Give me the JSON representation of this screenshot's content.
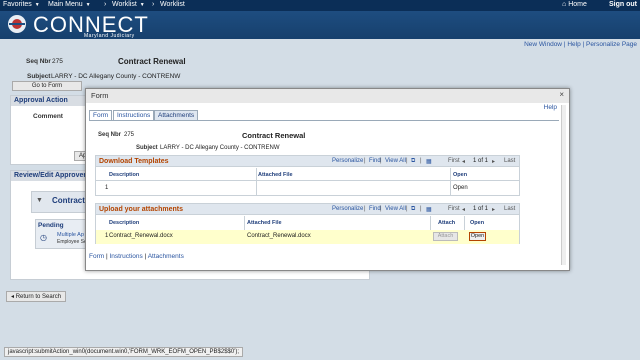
{
  "topnav": {
    "favorites": "Favorites",
    "main_menu": "Main Menu",
    "worklist1": "Worklist",
    "worklist2": "Worklist",
    "home": "Home",
    "signout": "Sign out"
  },
  "banner": {
    "logo_text": "CONNECT",
    "logo_sub": "Maryland Judiciary"
  },
  "page_links": {
    "new_window": "New Window",
    "help": "Help",
    "personalize": "Personalize Page",
    "sep": "|"
  },
  "bg": {
    "seq_label": "Seq Nbr",
    "seq_value": "275",
    "title": "Contract Renewal",
    "subject_label": "Subject",
    "subject_value": "LARRY - DC Allegany County - CONTRENW",
    "go_to_form": "Go to Form",
    "approval_action": "Approval Action",
    "comment_label": "Comment",
    "ap_button": "Ap",
    "review_edit": "Review/Edit Approvers",
    "contract_partial": "Contract",
    "pending": "Pending",
    "multiple_ap": "Multiple Ap",
    "employee_se": "Employee Se",
    "return_to_search": "Return to Search"
  },
  "modal": {
    "title": "Form",
    "help": "Help",
    "close": "×",
    "tabs": [
      "Form",
      "Instructions",
      "Attachments"
    ],
    "seq_label": "Seq Nbr",
    "seq_value": "275",
    "heading": "Contract Renewal",
    "subject_label": "Subject",
    "subject_value": "LARRY - DC Allegany County - CONTRENW",
    "download": {
      "title": "Download Templates",
      "personalize": "Personalize",
      "find": "Find",
      "view_all": "View All",
      "first": "First",
      "range": "1 of 1",
      "last": "Last",
      "columns": [
        "Description",
        "Attached File",
        "Open"
      ],
      "row_num": "1",
      "row_open": "Open"
    },
    "upload": {
      "title": "Upload your attachments",
      "personalize": "Personalize",
      "find": "Find",
      "view_all": "View All",
      "first": "First",
      "range": "1 of 1",
      "last": "Last",
      "columns": [
        "Description",
        "Attached File",
        "Attach",
        "Open"
      ],
      "row_num": "1",
      "row_desc": "Contract_Renewal.docx",
      "row_file": "Contract_Renewal.docx",
      "attach_btn": "Attach",
      "open_btn": "Open"
    },
    "footer_links": [
      "Form",
      "Instructions",
      "Attachments"
    ],
    "footer_sep": "|"
  },
  "status_bar": "javascript:submitAction_win0(document.win0,'FORM_WRK_EOFM_OPEN_PB$2$$0');",
  "colors": {
    "nav_bg": "#0b2e57",
    "banner_bg": "#1e4d80",
    "page_bg": "#d3dde6",
    "section_title": "#b34400",
    "link": "#2a55a0",
    "row_highlight": "#ffffcc"
  }
}
